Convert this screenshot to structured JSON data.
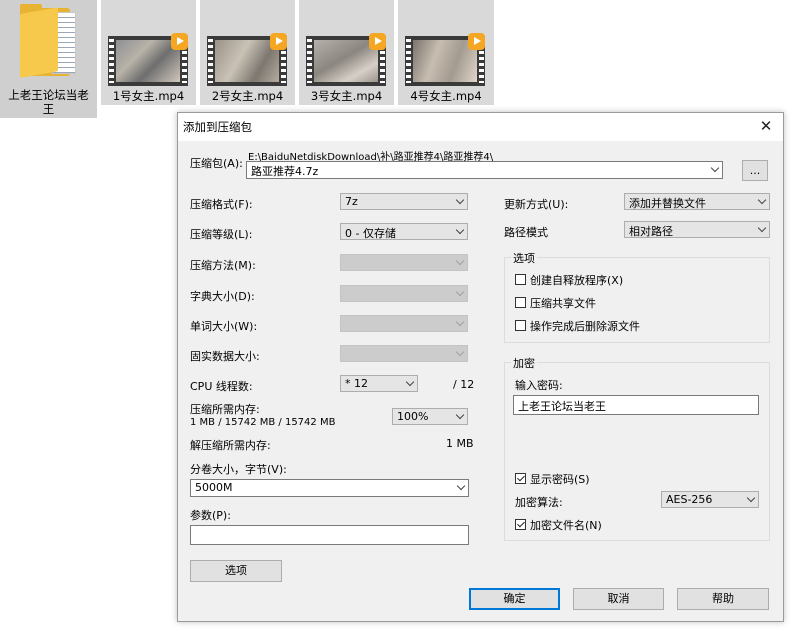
{
  "explorer": {
    "folder_label": "上老王论坛当老王",
    "files": [
      "1号女主.mp4",
      "2号女主.mp4",
      "3号女主.mp4",
      "4号女主.mp4"
    ]
  },
  "dialog": {
    "title": "添加到压缩包",
    "close_glyph": "✕",
    "archive": {
      "label": "压缩包(A):",
      "path": "E:\\BaiduNetdiskDownload\\补\\路亚推荐4\\路亚推荐4\\",
      "name": "路亚推荐4.7z",
      "browse_label": "..."
    },
    "format": {
      "label": "压缩格式(F):",
      "value": "7z"
    },
    "level": {
      "label": "压缩等级(L):",
      "value": "0 - 仅存储"
    },
    "method": {
      "label": "压缩方法(M):",
      "value": ""
    },
    "dict": {
      "label": "字典大小(D):",
      "value": ""
    },
    "word": {
      "label": "单词大小(W):",
      "value": ""
    },
    "solid": {
      "label": "固实数据大小:",
      "value": ""
    },
    "threads": {
      "label": "CPU 线程数:",
      "value": "* 12",
      "max": "/ 12"
    },
    "mem_compress": {
      "label": "压缩所需内存:",
      "detail": "1 MB / 15742 MB / 15742 MB",
      "value": "100%"
    },
    "mem_decompress": {
      "label": "解压缩所需内存:",
      "value": "1 MB"
    },
    "split": {
      "label": "分卷大小，字节(V):",
      "value": "5000M"
    },
    "params": {
      "label": "参数(P):",
      "value": ""
    },
    "options_button": "选项",
    "update": {
      "label": "更新方式(U):",
      "value": "添加并替换文件"
    },
    "path_mode": {
      "label": "路径模式",
      "value": "相对路径"
    },
    "options_group": {
      "title": "选项",
      "sfx": "创建自释放程序(X)",
      "shared": "压缩共享文件",
      "delete": "操作完成后删除源文件"
    },
    "encryption": {
      "title": "加密",
      "password_label": "输入密码:",
      "password": "上老王论坛当老王",
      "show_password": "显示密码(S)",
      "method_label": "加密算法:",
      "method": "AES-256",
      "encrypt_names": "加密文件名(N)"
    },
    "buttons": {
      "ok": "确定",
      "cancel": "取消",
      "help": "帮助"
    }
  }
}
